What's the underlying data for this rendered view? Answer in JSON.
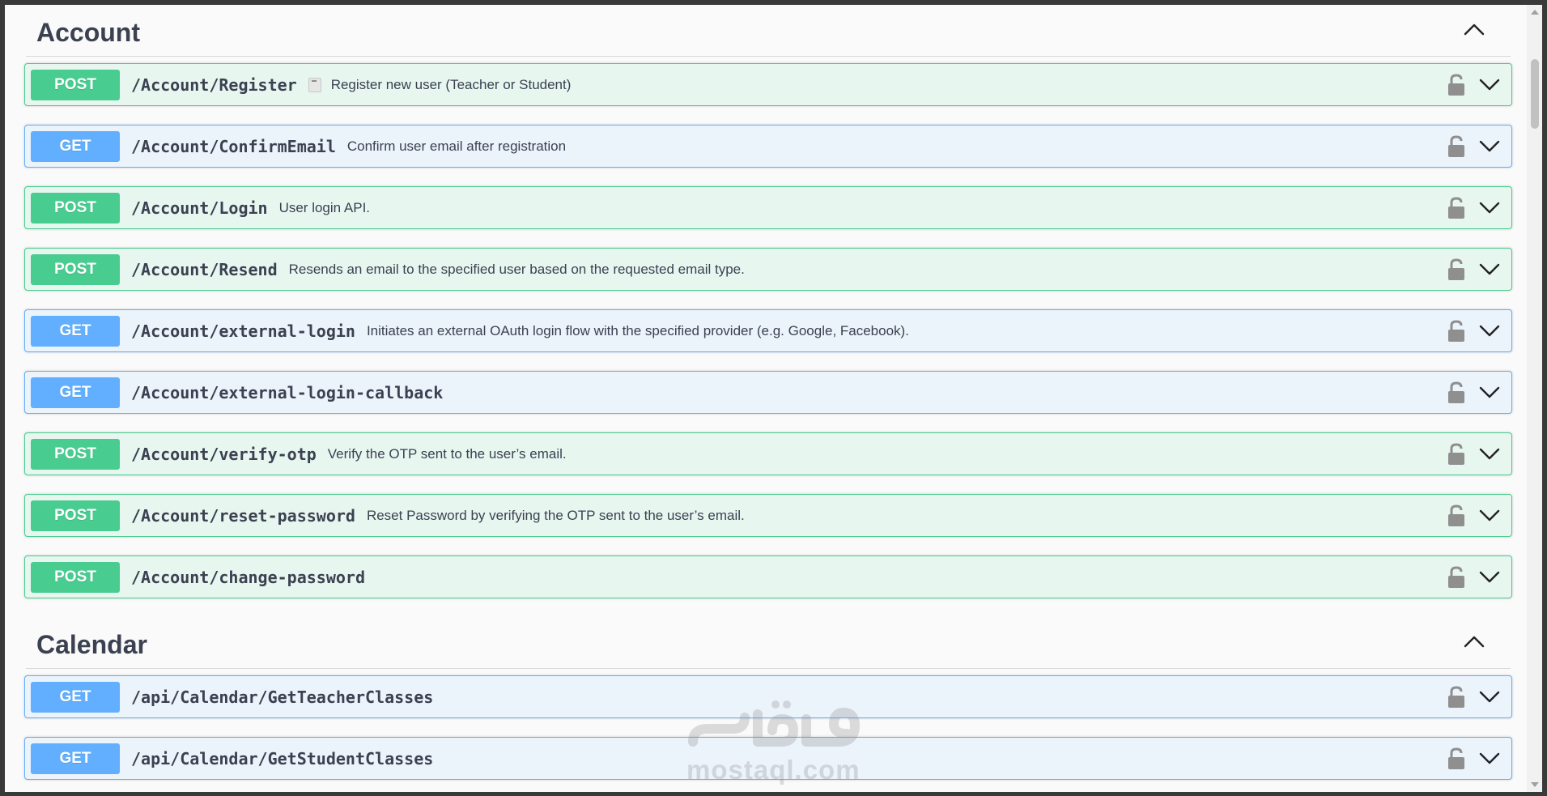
{
  "colors": {
    "post": "#49cc90",
    "post_bg": "#e8f6f0",
    "get": "#61affe",
    "get_bg": "#ebf3fb",
    "text": "#3b4151"
  },
  "sections": [
    {
      "title": "Account",
      "operations": [
        {
          "method": "POST",
          "path": "/Account/Register",
          "summary": "Register new user (Teacher or Student)",
          "emoji": "clipboard-icon"
        },
        {
          "method": "GET",
          "path": "/Account/ConfirmEmail",
          "summary": "Confirm user email after registration"
        },
        {
          "method": "POST",
          "path": "/Account/Login",
          "summary": "User login API."
        },
        {
          "method": "POST",
          "path": "/Account/Resend",
          "summary": "Resends an email to the specified user based on the requested email type."
        },
        {
          "method": "GET",
          "path": "/Account/external-login",
          "summary": "Initiates an external OAuth login flow with the specified provider (e.g. Google, Facebook)."
        },
        {
          "method": "GET",
          "path": "/Account/external-login-callback",
          "summary": ""
        },
        {
          "method": "POST",
          "path": "/Account/verify-otp",
          "summary": "Verify the OTP sent to the user’s email."
        },
        {
          "method": "POST",
          "path": "/Account/reset-password",
          "summary": "Reset Password by verifying the OTP sent to the user’s email."
        },
        {
          "method": "POST",
          "path": "/Account/change-password",
          "summary": ""
        }
      ]
    },
    {
      "title": "Calendar",
      "operations": [
        {
          "method": "GET",
          "path": "/api/Calendar/GetTeacherClasses",
          "summary": ""
        },
        {
          "method": "GET",
          "path": "/api/Calendar/GetStudentClasses",
          "summary": ""
        }
      ]
    }
  ],
  "watermark": {
    "text": "mostaql.com",
    "logo": "مستقل"
  }
}
